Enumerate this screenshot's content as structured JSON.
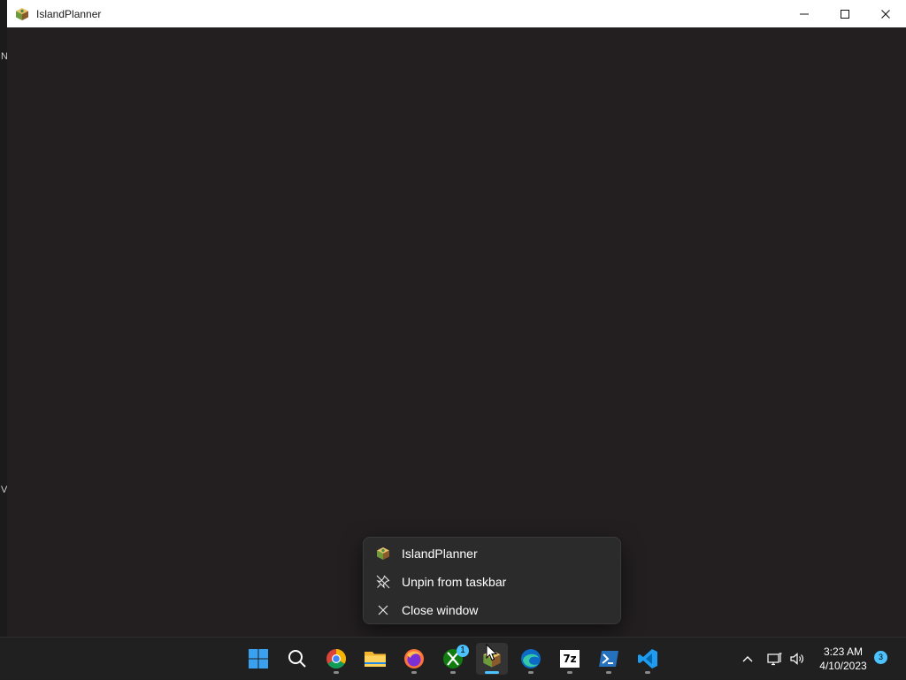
{
  "window": {
    "title": "IslandPlanner",
    "minimize_icon": "minimize-icon",
    "maximize_icon": "maximize-icon",
    "close_icon": "close-icon"
  },
  "desktop_edge": {
    "top_char": "N",
    "bottom_char": "V"
  },
  "jumplist": {
    "items": [
      {
        "label": "IslandPlanner",
        "icon": "islandplanner-app-icon"
      },
      {
        "label": "Unpin from taskbar",
        "icon": "unpin-icon"
      },
      {
        "label": "Close window",
        "icon": "close-icon"
      }
    ]
  },
  "taskbar": {
    "apps": [
      {
        "name": "Start",
        "icon": "windows-start-icon"
      },
      {
        "name": "Search",
        "icon": "search-icon"
      },
      {
        "name": "Chrome",
        "icon": "chrome-icon"
      },
      {
        "name": "File Explorer",
        "icon": "folder-icon"
      },
      {
        "name": "Firefox",
        "icon": "firefox-icon"
      },
      {
        "name": "Xbox",
        "icon": "xbox-icon",
        "badge": "1"
      },
      {
        "name": "IslandPlanner",
        "icon": "islandplanner-app-icon",
        "active": true
      },
      {
        "name": "Edge",
        "icon": "edge-icon"
      },
      {
        "name": "7-Zip",
        "icon": "7zip-icon",
        "text": "7z"
      },
      {
        "name": "PowerShell",
        "icon": "powershell-icon"
      },
      {
        "name": "VS Code",
        "icon": "vscode-icon"
      }
    ],
    "tray": {
      "chevron_icon": "chevron-up-icon",
      "network_icon": "network-icon",
      "volume_icon": "volume-icon"
    },
    "clock": {
      "time": "3:23 AM",
      "date": "4/10/2023"
    },
    "notification_count": "3"
  },
  "colors": {
    "accent": "#4cc2ff",
    "taskbar_bg": "#202020",
    "menu_bg": "#2b2b2b",
    "window_bg": "#231f20",
    "titlebar_bg": "#ffffff"
  }
}
